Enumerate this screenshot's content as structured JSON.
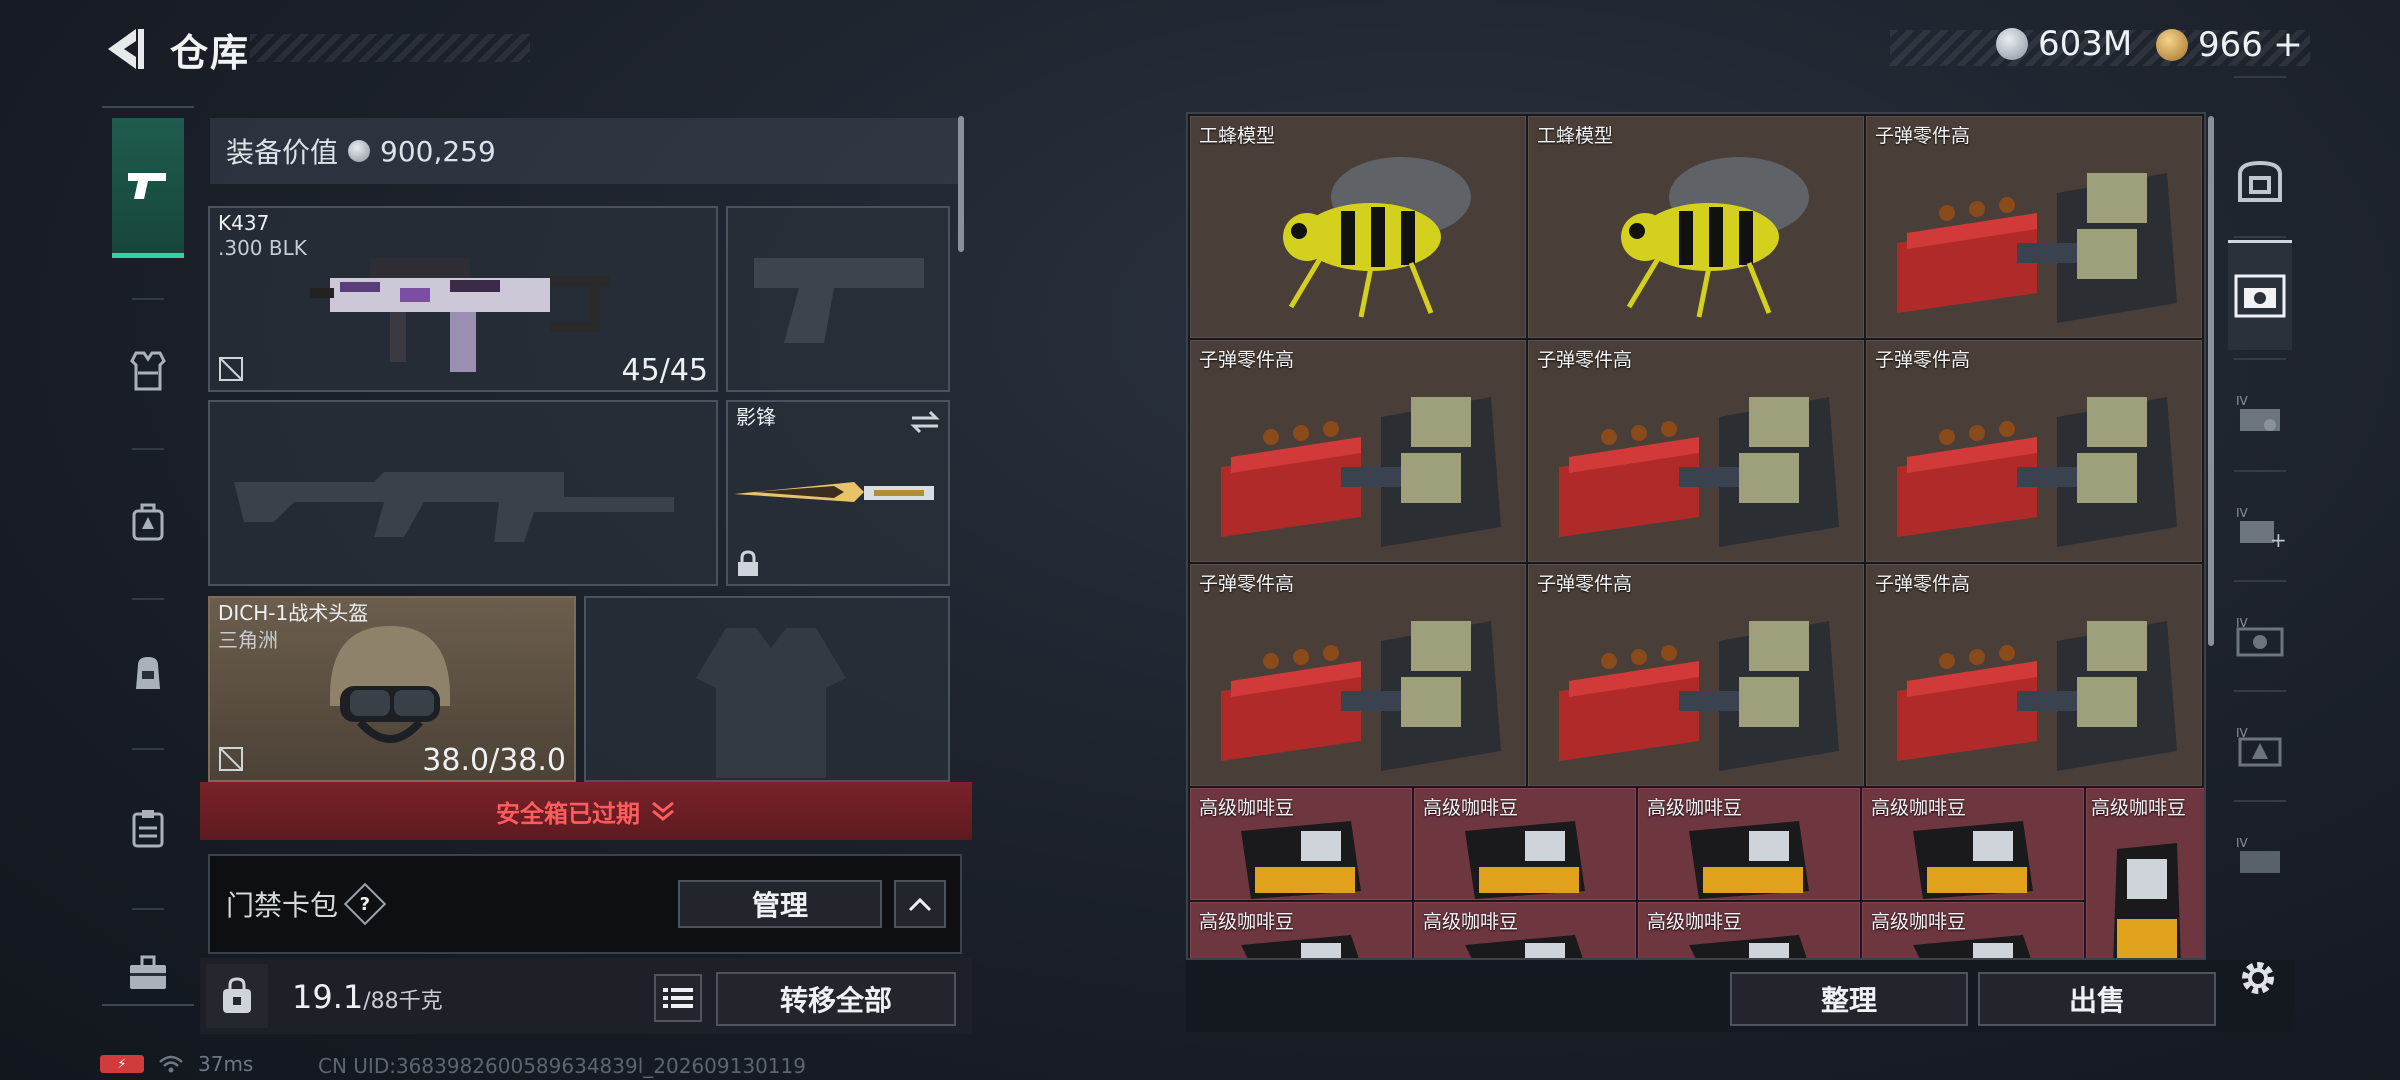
{
  "header": {
    "title": "仓库",
    "currency_silver": "603M",
    "currency_gold": "966"
  },
  "equipment": {
    "value_label": "装备价值",
    "value": "900,259",
    "primary_weapon": {
      "name": "K437",
      "ammo_type": ".300 BLK",
      "count": "45/45"
    },
    "melee": {
      "name": "影锋"
    },
    "helmet": {
      "name": "DICH-1战术头盔",
      "sub": "三角洲",
      "durability": "38.0/38.0"
    },
    "safe_box": "安全箱已过期",
    "keycard_label": "门禁卡包",
    "keycard_help": "?",
    "manage_button": "管理",
    "weight_value": "19.1",
    "weight_max": "/88千克",
    "transfer_all_button": "转移全部"
  },
  "stash": {
    "rows": [
      [
        {
          "label": "工蜂模型",
          "item": "wasp-drone-model"
        },
        {
          "label": "工蜂模型",
          "item": "wasp-drone-model"
        },
        {
          "label": "子弹零件高",
          "item": "ammo-parts-crate"
        }
      ],
      [
        {
          "label": "子弹零件高",
          "item": "ammo-parts-crate"
        },
        {
          "label": "子弹零件高",
          "item": "ammo-parts-crate"
        },
        {
          "label": "子弹零件高",
          "item": "ammo-parts-crate"
        }
      ],
      [
        {
          "label": "子弹零件高",
          "item": "ammo-parts-crate"
        },
        {
          "label": "子弹零件高",
          "item": "ammo-parts-crate"
        },
        {
          "label": "子弹零件高",
          "item": "ammo-parts-crate"
        }
      ]
    ],
    "coffee_row1": [
      "高级咖啡豆",
      "高级咖啡豆",
      "高级咖啡豆",
      "高级咖啡豆",
      "高级咖啡豆"
    ],
    "coffee_row2": [
      "高级咖啡豆",
      "高级咖啡豆",
      "高级咖啡豆",
      "高级咖啡豆"
    ],
    "sort_button": "整理",
    "sell_button": "出售"
  },
  "status_bar": {
    "ping": "37ms",
    "uid": "CN UID:3683982600589634839l_202609130119"
  },
  "colors": {
    "active_tab": "#2fd4a0",
    "safe_box_bg": "#7a2229",
    "safe_box_text": "#ff5d5d",
    "stash_cell_brown": "#4a3f38",
    "stash_cell_red": "#6e3740"
  }
}
